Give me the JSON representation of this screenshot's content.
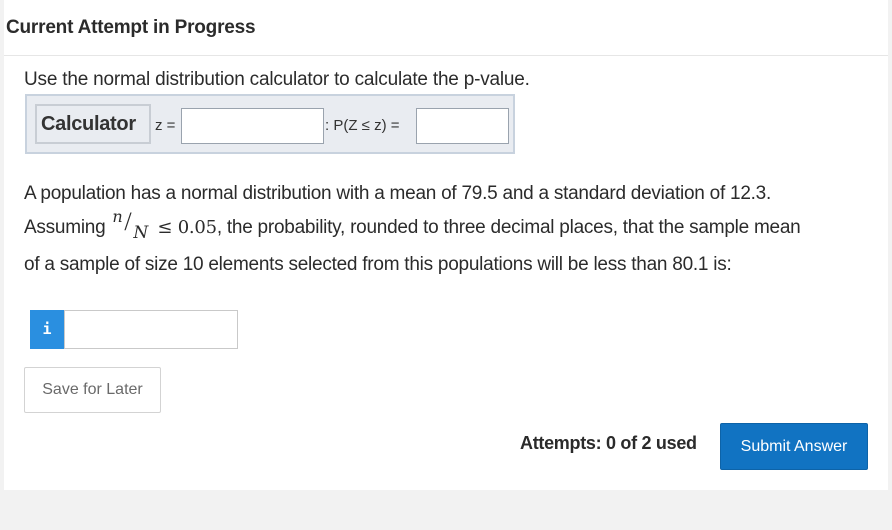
{
  "header": {
    "title": "Current Attempt in Progress"
  },
  "instruction": "Use the normal distribution calculator to calculate the p-value.",
  "calculator": {
    "button_label": "Calculator",
    "z_label": "z =",
    "z_value": "",
    "p_label": ": P(Z ≤ z) =",
    "p_value": ""
  },
  "question": {
    "line1": "A population has a normal distribution with a mean of 79.5 and a standard deviation of 12.3.",
    "line2_prefix": "Assuming",
    "frac_num": "n",
    "frac_den": "N",
    "line2_math": "≤ 0.05",
    "line2_suffix": ", the probability, rounded to three decimal places, that the sample mean",
    "line3": "of a sample of size 10 elements selected from this populations will be less than 80.1 is:"
  },
  "answer": {
    "info_icon": "i",
    "value": ""
  },
  "save_label": "Save for Later",
  "attempts_text": "Attempts: 0 of 2 used",
  "submit_label": "Submit Answer",
  "colors": {
    "accent": "#1173c2",
    "info": "#2a8fe0",
    "calc_bg": "#e9ecf1"
  }
}
